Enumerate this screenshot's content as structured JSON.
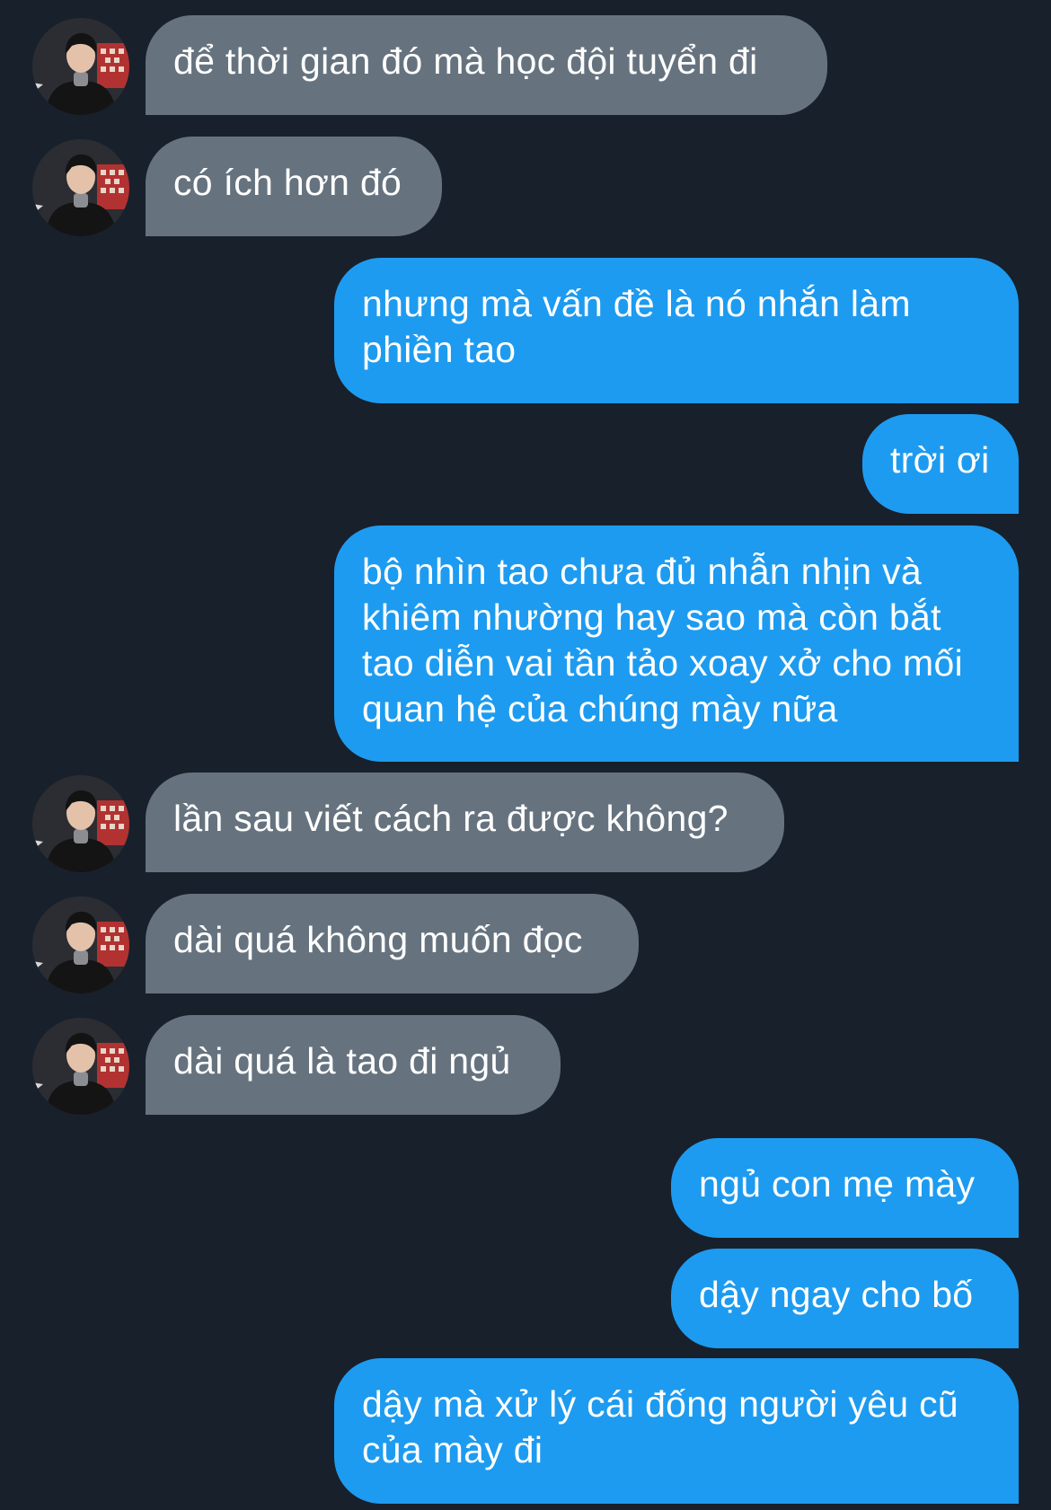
{
  "conversation": {
    "messages": [
      {
        "sender": "them",
        "text": "để thời gian đó mà học đội tuyển đi"
      },
      {
        "sender": "them",
        "text": "có ích hơn đó"
      },
      {
        "sender": "me",
        "text": "nhưng mà vấn đề là nó nhắn làm phiền tao"
      },
      {
        "sender": "me",
        "text": "trời ơi"
      },
      {
        "sender": "me",
        "text": "bộ nhìn tao chưa đủ nhẫn nhịn và khiêm nhường hay sao mà còn bắt tao diễn vai tần tảo xoay xở cho mối quan hệ của chúng mày nữa"
      },
      {
        "sender": "them",
        "text": "lần sau viết cách ra được không?"
      },
      {
        "sender": "them",
        "text": "dài quá không muốn đọc"
      },
      {
        "sender": "them",
        "text": "dài quá là tao đi ngủ"
      },
      {
        "sender": "me",
        "text": "ngủ con mẹ mày"
      },
      {
        "sender": "me",
        "text": "dậy ngay cho bố"
      },
      {
        "sender": "me",
        "text": "dậy mà xử lý cái đống người yêu cũ của mày đi"
      }
    ]
  },
  "colors": {
    "background": "#18202b",
    "incoming_bubble": "#66737f",
    "outgoing_bubble": "#1d9bf0",
    "text": "#ffffff"
  },
  "icons": {
    "avatar": "contact-avatar-photo"
  }
}
